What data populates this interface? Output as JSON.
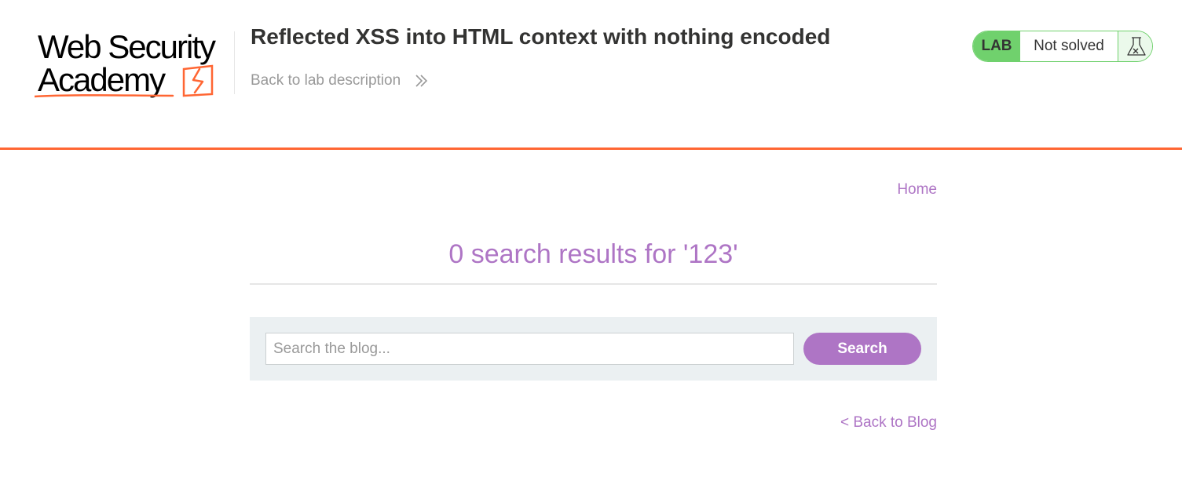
{
  "header": {
    "logo": {
      "line1": "Web Security",
      "line2": "Academy"
    },
    "lab_title": "Reflected XSS into HTML context with nothing encoded",
    "back_link": "Back to lab description",
    "status": {
      "badge": "LAB",
      "text": "Not solved",
      "icon": "flask-icon"
    }
  },
  "colors": {
    "accent_orange": "#ff6633",
    "purple": "#ae75c5",
    "lab_green": "#70d16d",
    "panel_bg": "#ebf0f2"
  },
  "nav": {
    "home": "Home"
  },
  "main": {
    "results_heading": "0 search results for '123'",
    "search": {
      "placeholder": "Search the blog...",
      "value": "",
      "button": "Search"
    },
    "back_to_blog": "< Back to Blog"
  }
}
